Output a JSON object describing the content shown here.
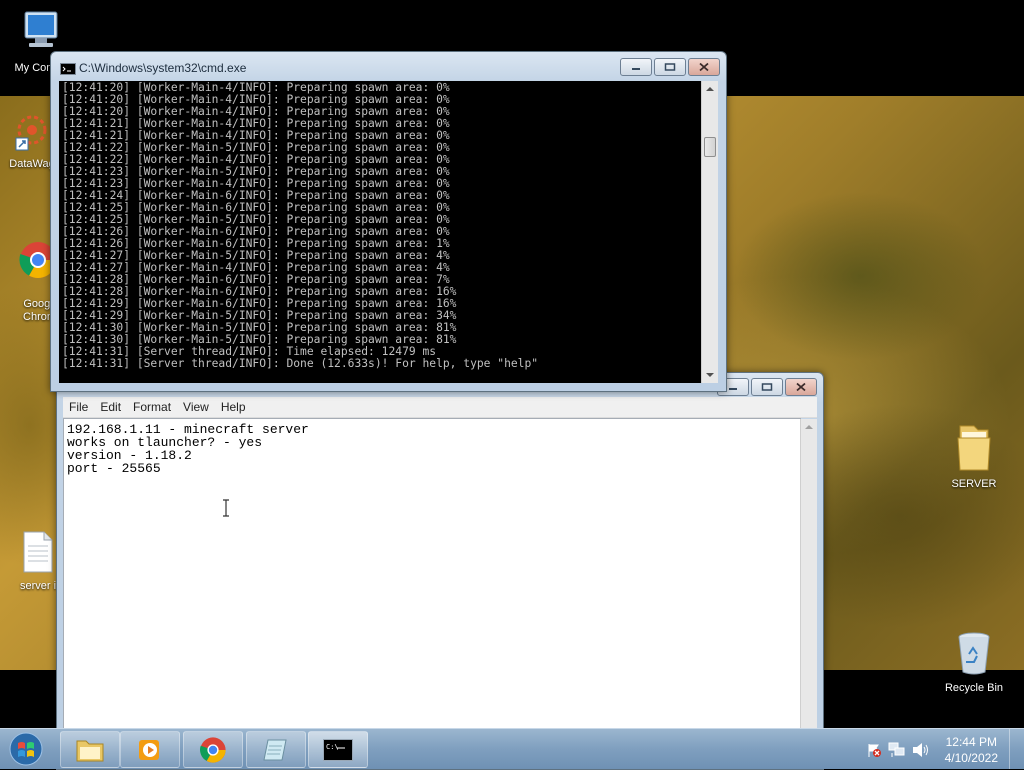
{
  "desktop": {
    "icons": [
      {
        "label": "My Comp"
      },
      {
        "label": "DataWag"
      },
      {
        "label": "Googl\nChron"
      },
      {
        "label": "server i"
      },
      {
        "label": "SERVER"
      },
      {
        "label": "Recycle Bin"
      }
    ]
  },
  "cmd": {
    "title": "C:\\Windows\\system32\\cmd.exe",
    "lines": [
      "[12:41:20] [Worker-Main-4/INFO]: Preparing spawn area: 0%",
      "[12:41:20] [Worker-Main-4/INFO]: Preparing spawn area: 0%",
      "[12:41:20] [Worker-Main-4/INFO]: Preparing spawn area: 0%",
      "[12:41:21] [Worker-Main-4/INFO]: Preparing spawn area: 0%",
      "[12:41:21] [Worker-Main-4/INFO]: Preparing spawn area: 0%",
      "[12:41:22] [Worker-Main-5/INFO]: Preparing spawn area: 0%",
      "[12:41:22] [Worker-Main-4/INFO]: Preparing spawn area: 0%",
      "[12:41:23] [Worker-Main-5/INFO]: Preparing spawn area: 0%",
      "[12:41:23] [Worker-Main-4/INFO]: Preparing spawn area: 0%",
      "[12:41:24] [Worker-Main-6/INFO]: Preparing spawn area: 0%",
      "[12:41:25] [Worker-Main-6/INFO]: Preparing spawn area: 0%",
      "[12:41:25] [Worker-Main-5/INFO]: Preparing spawn area: 0%",
      "[12:41:26] [Worker-Main-6/INFO]: Preparing spawn area: 0%",
      "[12:41:26] [Worker-Main-6/INFO]: Preparing spawn area: 1%",
      "[12:41:27] [Worker-Main-5/INFO]: Preparing spawn area: 4%",
      "[12:41:27] [Worker-Main-4/INFO]: Preparing spawn area: 4%",
      "[12:41:28] [Worker-Main-6/INFO]: Preparing spawn area: 7%",
      "[12:41:28] [Worker-Main-6/INFO]: Preparing spawn area: 16%",
      "[12:41:29] [Worker-Main-6/INFO]: Preparing spawn area: 16%",
      "[12:41:29] [Worker-Main-5/INFO]: Preparing spawn area: 34%",
      "[12:41:30] [Worker-Main-5/INFO]: Preparing spawn area: 81%",
      "[12:41:30] [Worker-Main-5/INFO]: Preparing spawn area: 81%",
      "[12:41:31] [Server thread/INFO]: Time elapsed: 12479 ms",
      "[12:41:31] [Server thread/INFO]: Done (12.633s)! For help, type \"help\""
    ]
  },
  "notepad": {
    "menu": [
      "File",
      "Edit",
      "Format",
      "View",
      "Help"
    ],
    "lines": [
      "192.168.1.11 - minecraft server",
      "works on tlauncher? - yes",
      "version - 1.18.2",
      "port - 25565"
    ]
  },
  "taskbar": {
    "items": [
      {
        "icon": "folder-icon"
      },
      {
        "icon": "media-player-icon"
      },
      {
        "icon": "chrome-icon"
      },
      {
        "icon": "notepad-icon"
      },
      {
        "icon": "cmd-icon",
        "active": true
      }
    ],
    "tray_icons": [
      "action-center-flag-icon",
      "network-icon",
      "volume-icon"
    ],
    "time": "12:44 PM",
    "date": "4/10/2022"
  }
}
